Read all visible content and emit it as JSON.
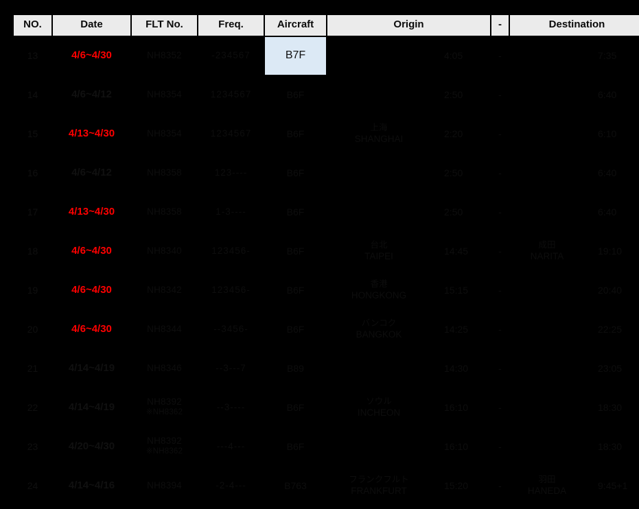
{
  "table": {
    "headers": {
      "no": "NO.",
      "date": "Date",
      "flt": "FLT No.",
      "freq": "Freq.",
      "aircraft": "Aircraft",
      "origin": "Origin",
      "dash": "-",
      "destination": "Destination"
    },
    "colors": {
      "header_bg": "#ebebeb",
      "body_bg": "#000000",
      "date_highlight": "#ff0000",
      "aircraft_highlight_bg": "#dce9f5",
      "dim_text": "#0d0d0d"
    },
    "rows": [
      {
        "no": "13",
        "date": "4/6~4/30",
        "date_red": true,
        "flt": "NH8352",
        "flt_note": "",
        "freq": "-234567",
        "aircraft": "B7F",
        "aircraft_highlight": true,
        "origin_jp": "",
        "origin_en": "",
        "dep": "4:05",
        "dash": "-",
        "dest_jp": "",
        "dest_en": "",
        "arr": "7:35"
      },
      {
        "no": "14",
        "date": "4/6~4/12",
        "date_red": false,
        "flt": "NH8354",
        "flt_note": "",
        "freq": "1234567",
        "aircraft": "B6F",
        "aircraft_highlight": false,
        "origin_jp": "",
        "origin_en": "",
        "dep": "2:50",
        "dash": "-",
        "dest_jp": "",
        "dest_en": "",
        "arr": "6:40"
      },
      {
        "no": "15",
        "date": "4/13~4/30",
        "date_red": true,
        "flt": "NH8354",
        "flt_note": "",
        "freq": "1234567",
        "aircraft": "B6F",
        "aircraft_highlight": false,
        "origin_jp": "上海",
        "origin_en": "SHANGHAI",
        "dep": "2:20",
        "dash": "-",
        "dest_jp": "",
        "dest_en": "",
        "arr": "6:10"
      },
      {
        "no": "16",
        "date": "4/6~4/12",
        "date_red": false,
        "flt": "NH8358",
        "flt_note": "",
        "freq": "123----",
        "aircraft": "B6F",
        "aircraft_highlight": false,
        "origin_jp": "",
        "origin_en": "",
        "dep": "2:50",
        "dash": "-",
        "dest_jp": "",
        "dest_en": "",
        "arr": "6:40"
      },
      {
        "no": "17",
        "date": "4/13~4/30",
        "date_red": true,
        "flt": "NH8358",
        "flt_note": "",
        "freq": "1-3----",
        "aircraft": "B6F",
        "aircraft_highlight": false,
        "origin_jp": "",
        "origin_en": "",
        "dep": "2:50",
        "dash": "-",
        "dest_jp": "",
        "dest_en": "",
        "arr": "6:40"
      },
      {
        "no": "18",
        "date": "4/6~4/30",
        "date_red": true,
        "flt": "NH8340",
        "flt_note": "",
        "freq": "123456-",
        "aircraft": "B6F",
        "aircraft_highlight": false,
        "origin_jp": "台北",
        "origin_en": "TAIPEI",
        "dep": "14:45",
        "dash": "-",
        "dest_jp": "成田",
        "dest_en": "NARITA",
        "arr": "19:10"
      },
      {
        "no": "19",
        "date": "4/6~4/30",
        "date_red": true,
        "flt": "NH8342",
        "flt_note": "",
        "freq": "123456-",
        "aircraft": "B6F",
        "aircraft_highlight": false,
        "origin_jp": "香港",
        "origin_en": "HONGKONG",
        "dep": "15:15",
        "dash": "-",
        "dest_jp": "",
        "dest_en": "",
        "arr": "20:40"
      },
      {
        "no": "20",
        "date": "4/6~4/30",
        "date_red": true,
        "flt": "NH8344",
        "flt_note": "",
        "freq": "--3456-",
        "aircraft": "B6F",
        "aircraft_highlight": false,
        "origin_jp": "バンコク",
        "origin_en": "BANGKOK",
        "dep": "14:25",
        "dash": "-",
        "dest_jp": "",
        "dest_en": "",
        "arr": "22:25"
      },
      {
        "no": "21",
        "date": "4/14~4/19",
        "date_red": false,
        "flt": "NH8346",
        "flt_note": "",
        "freq": "--3---7",
        "aircraft": "B89",
        "aircraft_highlight": false,
        "origin_jp": "",
        "origin_en": "",
        "dep": "14:30",
        "dash": "-",
        "dest_jp": "",
        "dest_en": "",
        "arr": "23:05"
      },
      {
        "no": "22",
        "date": "4/14~4/19",
        "date_red": false,
        "flt": "NH8392",
        "flt_note": "※NH8362",
        "freq": "--3----",
        "aircraft": "B6F",
        "aircraft_highlight": false,
        "origin_jp": "ソウル",
        "origin_en": "INCHEON",
        "dep": "16:10",
        "dash": "-",
        "dest_jp": "",
        "dest_en": "",
        "arr": "18:30"
      },
      {
        "no": "23",
        "date": "4/20~4/30",
        "date_red": false,
        "flt": "NH8392",
        "flt_note": "※NH8362",
        "freq": "---4---",
        "aircraft": "B6F",
        "aircraft_highlight": false,
        "origin_jp": "",
        "origin_en": "",
        "dep": "16:10",
        "dash": "-",
        "dest_jp": "",
        "dest_en": "",
        "arr": "18:30"
      },
      {
        "no": "24",
        "date": "4/14~4/16",
        "date_red": false,
        "flt": "NH8394",
        "flt_note": "",
        "freq": "-2-4---",
        "aircraft": "B763",
        "aircraft_highlight": false,
        "origin_jp": "フランクフルト",
        "origin_en": "FRANKFURT",
        "dep": "15:20",
        "dash": "-",
        "dest_jp": "羽田",
        "dest_en": "HANEDA",
        "arr": "9:45+1"
      }
    ]
  }
}
